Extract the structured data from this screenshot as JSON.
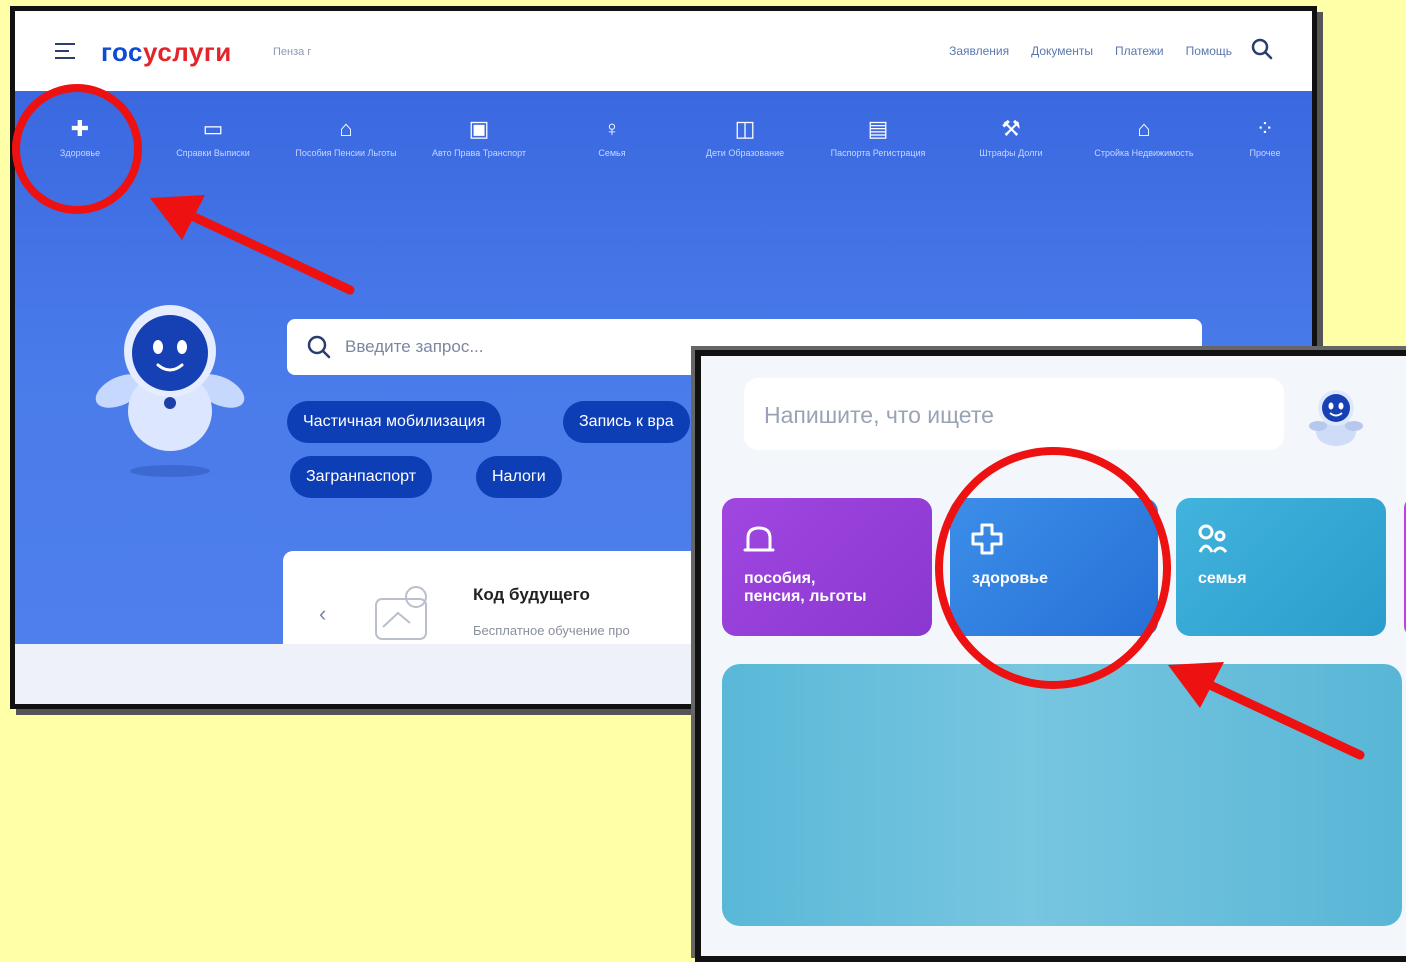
{
  "screen1": {
    "logo": {
      "part1": "гос",
      "part2": "услуги"
    },
    "city": "Пенза г",
    "nav": [
      "Заявления",
      "Документы",
      "Платежи",
      "Помощь"
    ],
    "categories": [
      {
        "icon": "plus-icon",
        "label": "Здоровье"
      },
      {
        "icon": "folder-icon",
        "label": "Справки Выписки"
      },
      {
        "icon": "wallet-icon",
        "label": "Пособия Пенсии Льготы"
      },
      {
        "icon": "car-icon",
        "label": "Авто Права Транспорт"
      },
      {
        "icon": "family-icon",
        "label": "Семья"
      },
      {
        "icon": "book-icon",
        "label": "Дети Образование"
      },
      {
        "icon": "passport-icon",
        "label": "Паспорта Регистрация"
      },
      {
        "icon": "gavel-icon",
        "label": "Штрафы Долги"
      },
      {
        "icon": "house-icon",
        "label": "Стройка Недвижимость"
      },
      {
        "icon": "grid-icon",
        "label": "Прочее"
      }
    ],
    "search_placeholder": "Введите запрос...",
    "chips": [
      "Частичная мобилизация",
      "Запись к вра",
      "Загранпаспорт",
      "Налоги"
    ],
    "card": {
      "title": "Код будущего",
      "subtitle": "Бесплатное обучение про"
    }
  },
  "screen2": {
    "search_placeholder": "Напишите, что ищете",
    "tiles": [
      {
        "icon": "wallet-icon",
        "label_line1": "пособия,",
        "label_line2": "пенсия, льготы",
        "color": "#9b3fdc"
      },
      {
        "icon": "plus-icon",
        "label_line1": "здоровье",
        "label_line2": "",
        "color": "#2d7fe0"
      },
      {
        "icon": "family-icon",
        "label_line1": "семья",
        "label_line2": "",
        "color": "#35a9d6"
      }
    ]
  },
  "colors": {
    "accent": "#0d4cd3",
    "highlight": "#ee1111",
    "background": "#ffffa8"
  }
}
